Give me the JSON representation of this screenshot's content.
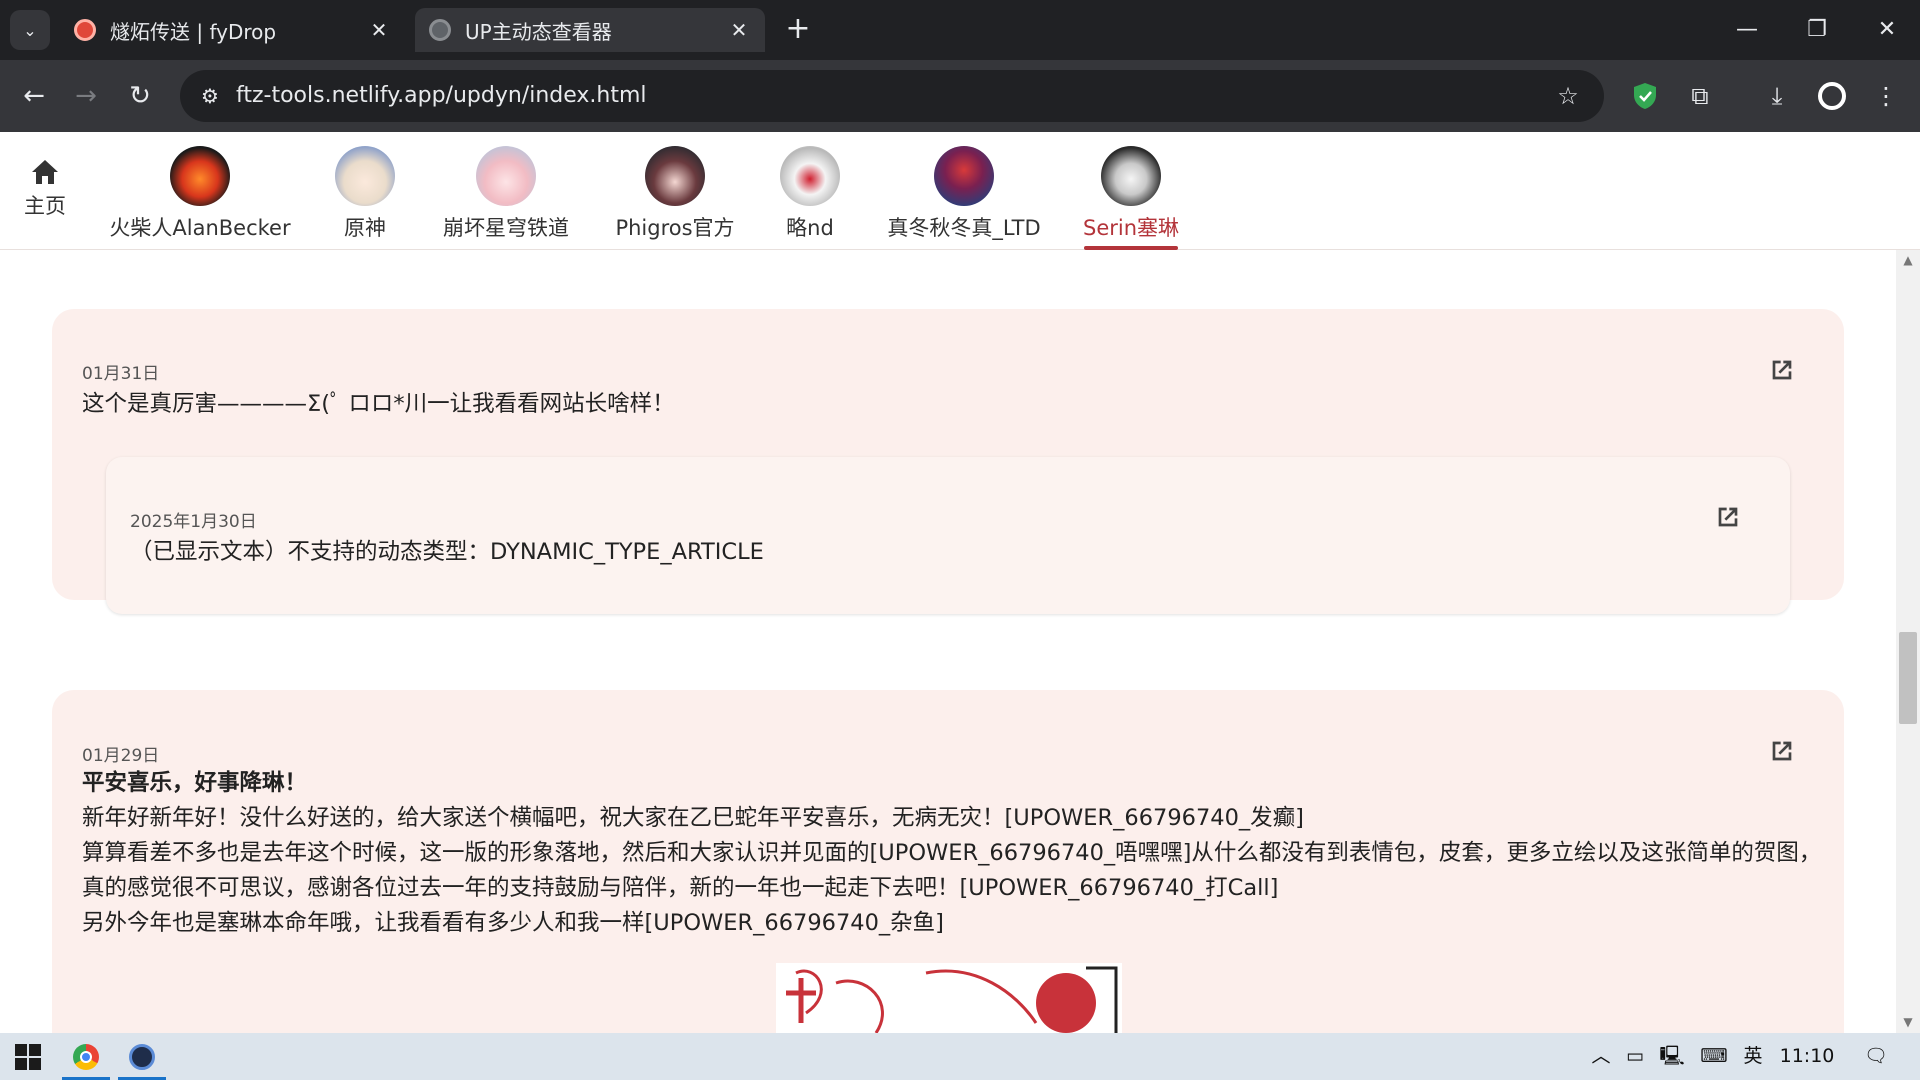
{
  "browser": {
    "tabs": [
      {
        "title": "燧炻传送 | fyDrop",
        "active": false
      },
      {
        "title": "UP主动态查看器",
        "active": true
      }
    ],
    "url": "ftz-tools.netlify.app/updyn/index.html"
  },
  "up_nav": {
    "home_label": "主页",
    "items": [
      {
        "name": "火柴人AlanBecker",
        "active": false
      },
      {
        "name": "原神",
        "active": false
      },
      {
        "name": "崩坏星穹铁道",
        "active": false
      },
      {
        "name": "Phigros官方",
        "active": false
      },
      {
        "name": "略nd",
        "active": false
      },
      {
        "name": "真冬秋冬真_LTD",
        "active": false
      },
      {
        "name": "Serin塞琳",
        "active": true
      }
    ],
    "accent_color": "#b3343a"
  },
  "feed": {
    "posts": [
      {
        "date": "01月31日",
        "text": "这个是真厉害————Σ(ﾟ ロロ*川一让我看看网站长啥样！",
        "forward": {
          "date": "2025年1月30日",
          "text": "（已显示文本）不支持的动态类型：DYNAMIC_TYPE_ARTICLE"
        }
      },
      {
        "date": "01月29日",
        "title": "平安喜乐，好事降琳！",
        "lines": [
          "新年好新年好！没什么好送的，给大家送个横幅吧，祝大家在乙巳蛇年平安喜乐，无病无灾！[UPOWER_66796740_发癫]",
          "算算看差不多也是去年这个时候，这一版的形象落地，然后和大家认识并见面的[UPOWER_66796740_唔嘿嘿]从什么都没有到表情包，皮套，更多立绘以及这张简单的贺图，真的感觉很不可思议，感谢各位过去一年的支持鼓励与陪伴，新的一年也一起走下去吧！[UPOWER_66796740_打Call]",
          "另外今年也是塞琳本命年哦，让我看看有多少人和我一样[UPOWER_66796740_杂鱼]"
        ]
      }
    ],
    "card_color": "#fcefec"
  },
  "taskbar": {
    "ime": "英",
    "time": "11:10"
  }
}
